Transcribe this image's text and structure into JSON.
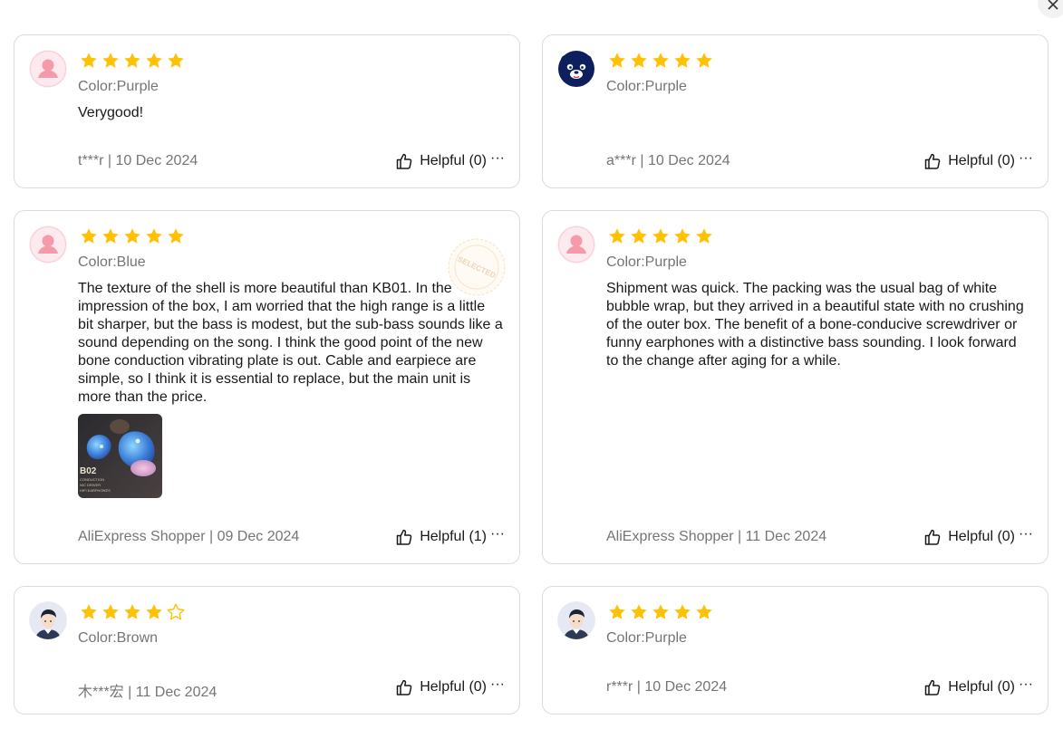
{
  "accent_star_color": "#FFC106",
  "reviews": [
    {
      "avatar": "default-pink",
      "rating": 5,
      "color_label": "Color:Purple",
      "text": "Verygood!",
      "author": "t***r | 10 Dec 2024",
      "helpful": "Helpful (0)"
    },
    {
      "avatar": "bear-navy",
      "rating": 5,
      "color_label": "Color:Purple",
      "text": "",
      "author": "a***r | 10 Dec 2024",
      "helpful": "Helpful (0)"
    },
    {
      "avatar": "default-pink",
      "rating": 5,
      "color_label": "Color:Blue",
      "text": "The texture of the shell is more beautiful than KB01. In the impression of the box, I am worried that the high range is a little bit sharper, but the bass is modest, but the sub-bass sounds like a sound depending on the song. I think the good point of the new bone conduction vibrating plate is out. Cable and earpiece are simple, so I think it is essential to replace, but the main unit is more than the price.",
      "author": "AliExpress Shopper | 09 Dec 2024",
      "helpful": "Helpful (1)",
      "stamp": "SELECTED",
      "photo_caption": [
        "B02",
        "CONDUCTION",
        "NIC DRIVER",
        "HIFI EARPHONES"
      ]
    },
    {
      "avatar": "default-pink",
      "rating": 5,
      "color_label": "Color:Purple",
      "text": "Shipment was quick. The packing was the usual bag of white bubble wrap, but they arrived in a beautiful state with no crushing of the outer box. The benefit of a bone-conducive screwdriver or funny earphones with a distinctive bass sounding. I look forward to the change after aging for a while.",
      "author": "AliExpress Shopper | 11 Dec 2024",
      "helpful": "Helpful (0)"
    },
    {
      "avatar": "cartoon-man",
      "rating": 4,
      "color_label": "Color:Brown",
      "text": "",
      "author": "木***宏 | 11 Dec 2024",
      "helpful": "Helpful (0)"
    },
    {
      "avatar": "cartoon-man",
      "rating": 5,
      "color_label": "Color:Purple",
      "text": "",
      "author": "r***r | 10 Dec 2024",
      "helpful": "Helpful (0)"
    }
  ],
  "more_glyph": "···"
}
